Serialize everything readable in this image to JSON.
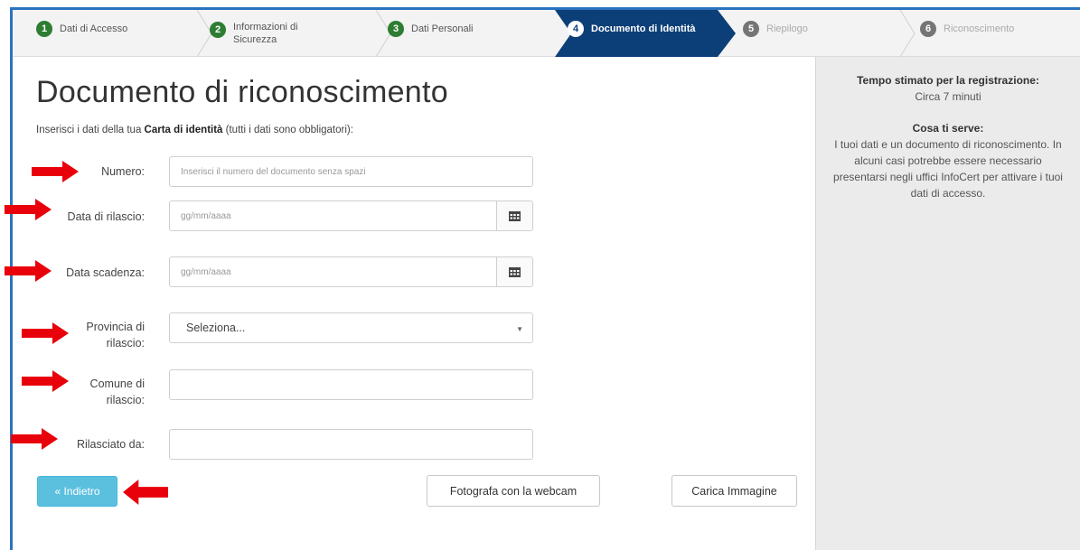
{
  "steps": [
    {
      "num": "1",
      "label": "Dati di Accesso"
    },
    {
      "num": "2",
      "label_line1": "Informazioni di",
      "label_line2": "Sicurezza"
    },
    {
      "num": "3",
      "label": "Dati Personali"
    },
    {
      "num": "4",
      "label": "Documento di Identità"
    },
    {
      "num": "5",
      "label": "Riepilogo"
    },
    {
      "num": "6",
      "label": "Riconoscimento"
    }
  ],
  "page": {
    "title": "Documento di riconoscimento",
    "intro_prefix": "Inserisci i dati della tua ",
    "intro_bold": "Carta di identità",
    "intro_suffix": " (tutti i dati sono obbligatori):"
  },
  "form": {
    "numero_label": "Numero:",
    "numero_placeholder": "Inserisci il numero del documento senza spazi",
    "data_rilascio_label": "Data di rilascio:",
    "data_rilascio_placeholder": "gg/mm/aaaa",
    "data_scadenza_label": "Data scadenza:",
    "data_scadenza_placeholder": "gg/mm/aaaa",
    "provincia_label_1": "Provincia di",
    "provincia_label_2": "rilascio:",
    "provincia_value": "Seleziona...",
    "comune_label_1": "Comune di",
    "comune_label_2": "rilascio:",
    "comune_value": "",
    "rilasciato_label": "Rilasciato da:",
    "rilasciato_value": ""
  },
  "buttons": {
    "back": "« Indietro",
    "webcam": "Fotografa con la webcam",
    "upload": "Carica Immagine"
  },
  "sidebar": {
    "time_heading": "Tempo stimato per la registrazione:",
    "time_value": "Circa 7 minuti",
    "need_heading": "Cosa ti serve:",
    "need_text": "I tuoi dati e un documento di riconoscimento. In alcuni casi potrebbe essere necessario presentarsi negli uffici InfoCert per attivare i tuoi dati di accesso."
  },
  "colors": {
    "active_step": "#0c3f78",
    "step_done": "#2e7d32",
    "back_button": "#5bc0de",
    "annotation_arrow": "#e8000b"
  }
}
